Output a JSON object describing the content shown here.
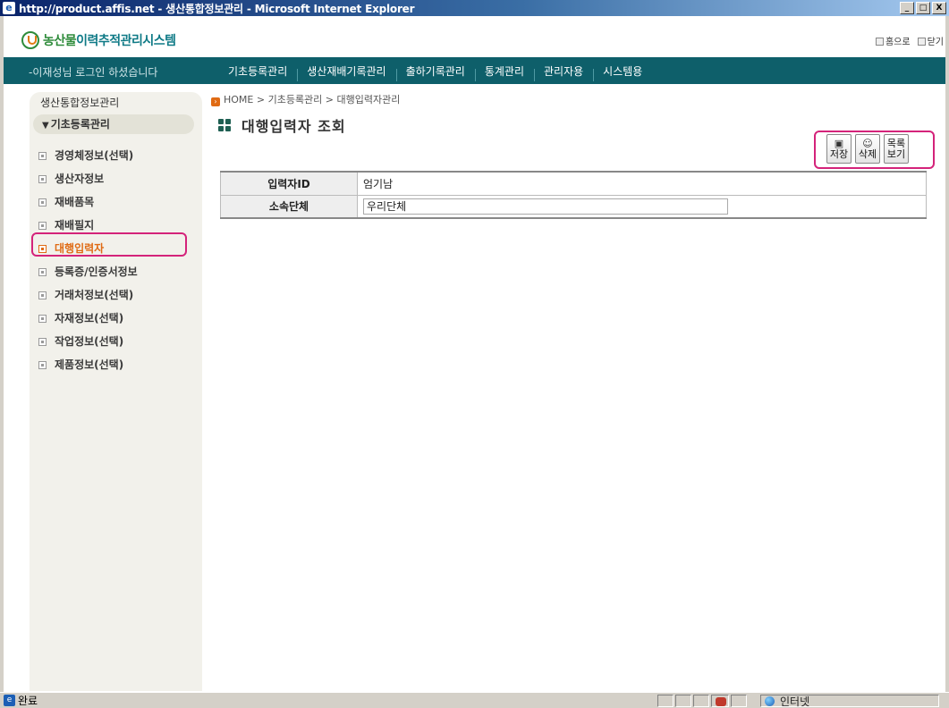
{
  "window": {
    "title": "http://product.affis.net - 생산통합정보관리 - Microsoft Internet Explorer",
    "buttons": [
      "_",
      "□",
      "X"
    ]
  },
  "header": {
    "logo_highlight": "농산물",
    "logo_rest": "이력추적관리시스템",
    "links": {
      "home": "홈으로",
      "close": "닫기"
    }
  },
  "nav": {
    "login_message": "-이재성님 로그인 하셨습니다",
    "menu": [
      "기초등록관리",
      "생산재배기록관리",
      "출하기록관리",
      "통계관리",
      "관리자용",
      "시스템용"
    ]
  },
  "sidebar": {
    "title": "생산통합정보관리",
    "category": "기초등록관리",
    "items": [
      {
        "label": "경영체정보(선택)"
      },
      {
        "label": "생산자정보"
      },
      {
        "label": "재배품목"
      },
      {
        "label": "재배필지"
      },
      {
        "label": "대행입력자",
        "active": true
      },
      {
        "label": "등록증/인증서정보"
      },
      {
        "label": "거래처정보(선택)"
      },
      {
        "label": "자재정보(선택)"
      },
      {
        "label": "작업정보(선택)"
      },
      {
        "label": "제품정보(선택)"
      }
    ]
  },
  "main": {
    "breadcrumb": "HOME > 기초등록관리 > 대행입력자관리",
    "page_title": "대행입력자 조회",
    "buttons": {
      "save": "저장",
      "delete": "삭제",
      "list_line1": "목록",
      "list_line2": "보기"
    },
    "fields": [
      {
        "label": "입력자ID",
        "value": "엄기남"
      },
      {
        "label": "소속단체",
        "value": "우리단체"
      }
    ]
  },
  "statusbar": {
    "status": "완료",
    "zone": "인터넷"
  },
  "colors": {
    "nav_bg": "#0e5f6a",
    "accent": "#e06b14",
    "highlight_border": "#d4237a",
    "logo_green": "#2e8b3a",
    "logo_teal": "#0f7a86"
  }
}
